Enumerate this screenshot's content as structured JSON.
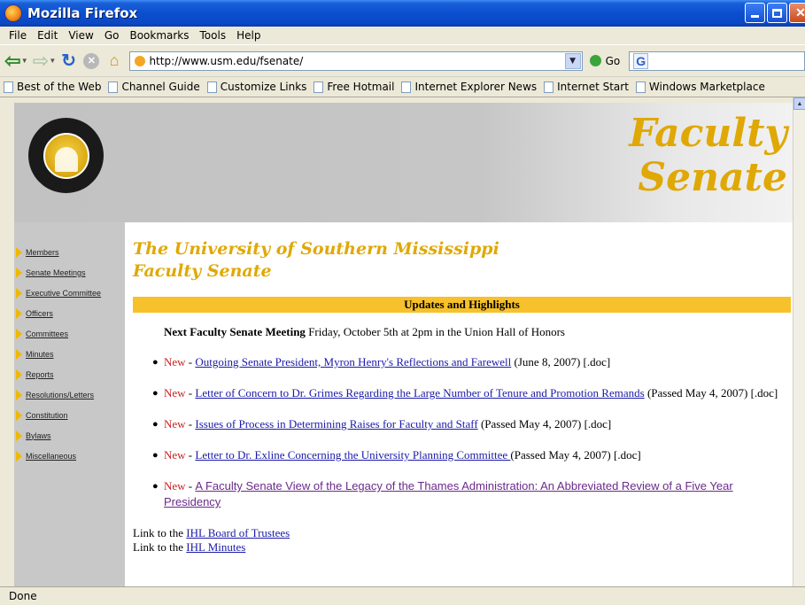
{
  "window": {
    "title": "Mozilla Firefox"
  },
  "menu": {
    "items": [
      "File",
      "Edit",
      "View",
      "Go",
      "Bookmarks",
      "Tools",
      "Help"
    ]
  },
  "nav": {
    "url": "http://www.usm.edu/fsenate/",
    "go_label": "Go",
    "search_logo": "G"
  },
  "bookmarks": [
    "Best of the Web",
    "Channel Guide",
    "Customize Links",
    "Free Hotmail",
    "Internet Explorer News",
    "Internet Start",
    "Windows Marketplace"
  ],
  "page": {
    "header_title_line1": "Faculty",
    "header_title_line2": "Senate",
    "univ_title_line1": "The University of Southern Mississippi",
    "univ_title_line2": "Faculty Senate",
    "sidebar": [
      "Members",
      "Senate Meetings",
      "Executive Committee",
      "Officers",
      "Committees",
      "Minutes",
      "Reports",
      "Resolutions/Letters",
      "Constitution",
      "Bylaws",
      "Miscellaneous"
    ],
    "highlights_header": "Updates and Highlights",
    "next_meeting_label": "Next Faculty Senate Meeting",
    "next_meeting_text": " Friday, October 5th at 2pm in the Union Hall of Honors",
    "new_label": "New",
    "items": [
      {
        "link": "Outgoing Senate President, Myron Henry's Reflections and Farewell",
        "suffix": " (June 8, 2007) [.doc]"
      },
      {
        "link": "Letter of Concern to Dr. Grimes Regarding the Large Number of Tenure and Promotion Remands",
        "suffix": " (Passed May 4, 2007) [.doc]"
      },
      {
        "link": "Issues of Process in Determining Raises for Faculty and Staff",
        "suffix": " (Passed May 4, 2007) [.doc]"
      },
      {
        "link": "Letter to Dr. Exline Concerning the University Planning Committee ",
        "suffix": "(Passed May 4, 2007) [.doc]"
      },
      {
        "link": "A Faculty Senate View of the Legacy of the Thames Administration: An Abbreviated Review of a Five Year Presidency",
        "suffix": ""
      }
    ],
    "footer_links": [
      {
        "prefix": "Link to the ",
        "link": "IHL Board of Trustees"
      },
      {
        "prefix": "Link to the ",
        "link": "IHL Minutes"
      }
    ]
  },
  "status": {
    "text": "Done"
  },
  "colors": {
    "gold": "#e0a805",
    "highlight_bar": "#f7c12b",
    "sidebar_bg": "#c8c8c8",
    "new_red": "#cc2020",
    "link_blue": "#1a1aa8"
  }
}
